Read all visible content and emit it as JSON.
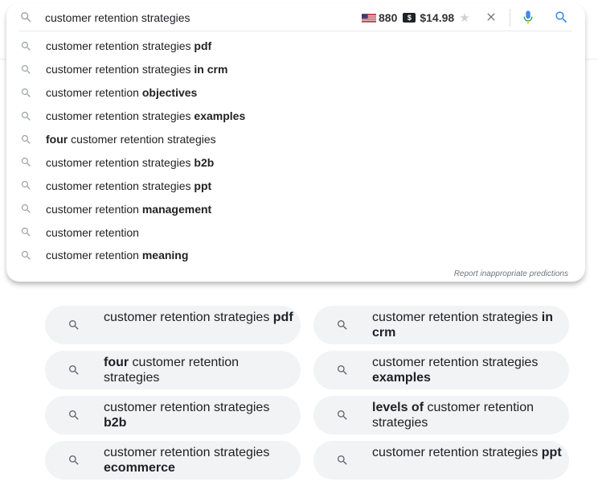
{
  "search": {
    "query": "customer retention strategies",
    "placeholder": ""
  },
  "keyword_extension": {
    "volume": "880",
    "cpc": "$14.98",
    "cpc_icon": "$"
  },
  "suggestions": [
    {
      "pre": "customer retention strategies ",
      "bold": "pdf",
      "post": ""
    },
    {
      "pre": "customer retention strategies ",
      "bold": "in crm",
      "post": ""
    },
    {
      "pre": "customer retention ",
      "bold": "objectives",
      "post": ""
    },
    {
      "pre": "customer retention strategies ",
      "bold": "examples",
      "post": ""
    },
    {
      "pre": "",
      "bold": "four",
      "post": " customer retention strategies"
    },
    {
      "pre": "customer retention strategies ",
      "bold": "b2b",
      "post": ""
    },
    {
      "pre": "customer retention strategies ",
      "bold": "ppt",
      "post": ""
    },
    {
      "pre": "customer retention ",
      "bold": "management",
      "post": ""
    },
    {
      "pre": "customer retention",
      "bold": "",
      "post": ""
    },
    {
      "pre": "customer retention ",
      "bold": "meaning",
      "post": ""
    }
  ],
  "report_link": "Report inappropriate predictions",
  "related_searches": [
    {
      "pre": "customer retention strategies ",
      "bold": "pdf",
      "post": ""
    },
    {
      "pre": "customer retention strategies ",
      "bold": "in crm",
      "post": ""
    },
    {
      "pre": "",
      "bold": "four",
      "post": " customer retention strategies"
    },
    {
      "pre": "customer retention strategies ",
      "bold": "examples",
      "post": ""
    },
    {
      "pre": "customer retention strategies ",
      "bold": "b2b",
      "post": ""
    },
    {
      "pre": "",
      "bold": "levels of",
      "post": " customer retention strategies"
    },
    {
      "pre": "customer retention strategies ",
      "bold": "ecommerce",
      "post": ""
    },
    {
      "pre": "customer retention strategies ",
      "bold": "ppt",
      "post": ""
    }
  ],
  "icons": {
    "lead": "search-icon",
    "suggestion": "search-icon",
    "clear": "close-icon",
    "mic": "microphone-icon",
    "submit": "search-icon",
    "star": "star-icon",
    "flag": "us-flag-icon",
    "dollar": "dollar-icon"
  },
  "colors": {
    "search_blue": "#4285f4",
    "chip_bg": "#f1f3f4",
    "text": "#202124",
    "icon_gray": "#9aa0a6"
  }
}
